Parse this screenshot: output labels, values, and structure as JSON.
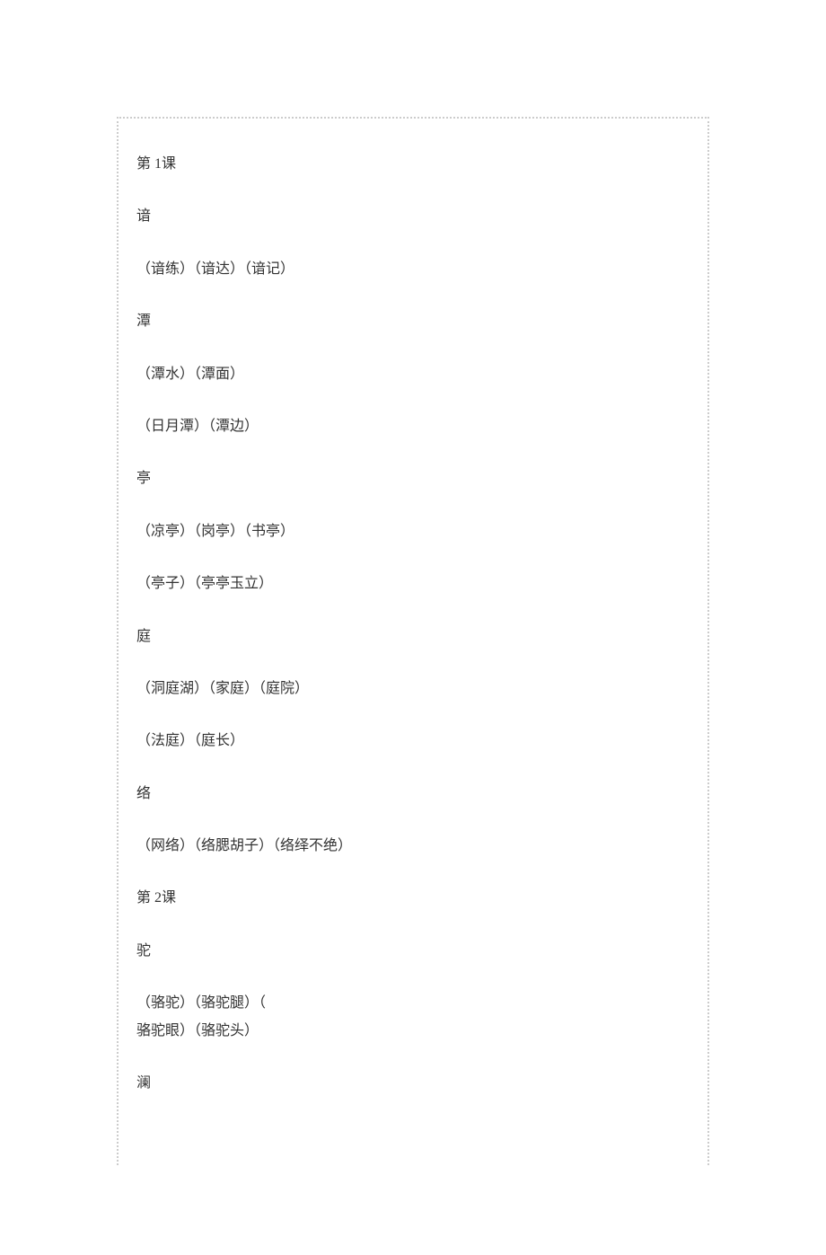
{
  "lines": [
    "第 1课",
    "谙",
    "（谙练）（谙达）（谙记）",
    "潭",
    "（潭水）（潭面）",
    "（日月潭）（潭边）",
    "亭",
    "（凉亭）（岗亭）（书亭）",
    "（亭子）（亭亭玉立）",
    "庭",
    "（洞庭湖）（家庭）（庭院）",
    "（法庭）（庭长）",
    "络",
    "（网络）（络腮胡子）（络绎不绝）",
    "第 2课",
    "驼",
    "（骆驼）（骆驼腿）（",
    "骆驼眼）（骆驼头）",
    "澜"
  ]
}
